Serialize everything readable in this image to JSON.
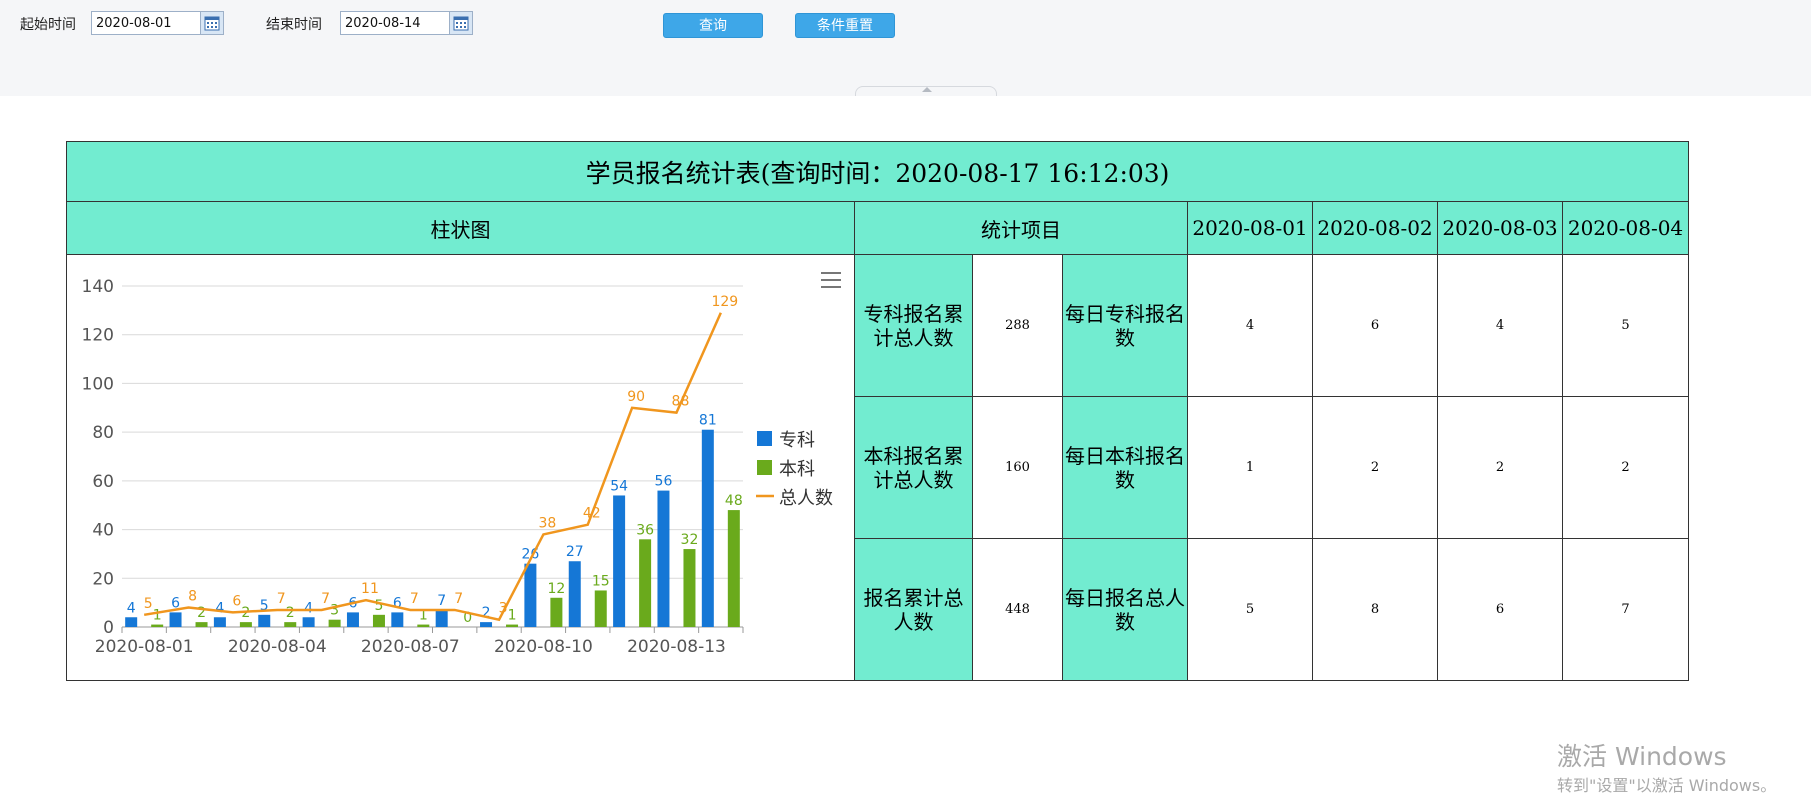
{
  "filters": {
    "start_label": "起始时间",
    "start_value": "2020-08-01",
    "end_label": "结束时间",
    "end_value": "2020-08-14",
    "query_button": "查询",
    "reset_button": "条件重置"
  },
  "table": {
    "title": "学员报名统计表(查询时间：2020-08-17 16:12:03)",
    "chart_header": "柱状图",
    "item_header": "统计项目",
    "dates": [
      "2020-08-01",
      "2020-08-02",
      "2020-08-03",
      "2020-08-04"
    ],
    "rows": [
      {
        "total_label": "专科报名累计总人数",
        "total_value": "288",
        "daily_label": "每日专科报名数",
        "values": [
          "4",
          "6",
          "4",
          "5"
        ]
      },
      {
        "total_label": "本科报名累计总人数",
        "total_value": "160",
        "daily_label": "每日本科报名数",
        "values": [
          "1",
          "2",
          "2",
          "2"
        ]
      },
      {
        "total_label": "报名累计总人数",
        "total_value": "448",
        "daily_label": "每日报名总人数",
        "values": [
          "5",
          "8",
          "6",
          "7"
        ]
      }
    ]
  },
  "chart_data": {
    "type": "bar",
    "title": "",
    "xlabel": "",
    "ylabel": "",
    "ylim": [
      0,
      140
    ],
    "yticks": [
      0,
      20,
      40,
      60,
      80,
      100,
      120,
      140
    ],
    "categories": [
      "2020-08-01",
      "2020-08-02",
      "2020-08-03",
      "2020-08-04",
      "2020-08-05",
      "2020-08-06",
      "2020-08-07",
      "2020-08-08",
      "2020-08-09",
      "2020-08-10",
      "2020-08-11",
      "2020-08-12",
      "2020-08-13",
      "2020-08-14"
    ],
    "xtick_labels": [
      "2020-08-01",
      "2020-08-04",
      "2020-08-07",
      "2020-08-10",
      "2020-08-13"
    ],
    "series": [
      {
        "name": "专科",
        "type": "bar",
        "color": "#1577d6",
        "values": [
          4,
          6,
          4,
          5,
          4,
          6,
          6,
          7,
          2,
          26,
          27,
          54,
          56,
          81
        ]
      },
      {
        "name": "本科",
        "type": "bar",
        "color": "#6aaa1c",
        "values": [
          1,
          2,
          2,
          2,
          3,
          5,
          1,
          0,
          1,
          12,
          15,
          36,
          32,
          48
        ]
      },
      {
        "name": "总人数",
        "type": "line",
        "color": "#f0961e",
        "values": [
          5,
          8,
          6,
          7,
          7,
          11,
          7,
          7,
          3,
          38,
          42,
          90,
          88,
          129
        ]
      }
    ],
    "legend_position": "right",
    "grid": true
  },
  "icons": {
    "calendar": "calendar-icon",
    "menu": "menu-icon"
  },
  "watermark": {
    "line1": "激活 Windows",
    "line2": "转到\"设置\"以激活 Windows。"
  }
}
